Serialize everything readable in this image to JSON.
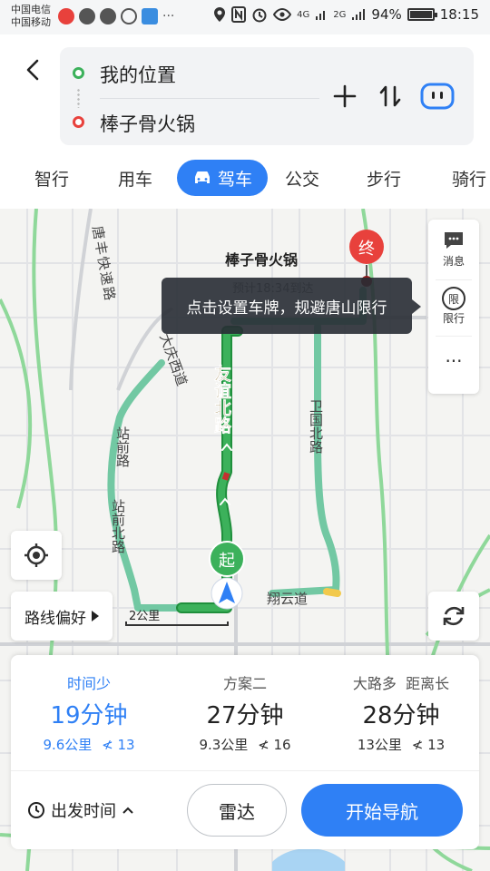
{
  "status_bar": {
    "carrier_1": "中国电信",
    "carrier_2": "中国移动",
    "network_4g": "4G",
    "network_2g": "2G",
    "battery": "94%",
    "battery_level": 0.94,
    "time": "18:15"
  },
  "route": {
    "origin": "我的位置",
    "destination": "棒子骨火锅"
  },
  "modes": [
    "智行",
    "用车",
    "驾车",
    "公交",
    "步行",
    "骑行"
  ],
  "active_mode": "驾车",
  "map": {
    "destination_label": "棒子骨火锅",
    "end_marker": "终",
    "start_marker": "起",
    "tooltip": "点击设置车牌，规避唐山限行",
    "road_labels": [
      "唐丰快速路",
      "友谊北路",
      "卫国北路",
      "站前北路",
      "站前路",
      "翔云道",
      "大庆西道"
    ],
    "eta_strip": "预计18:34到达",
    "scale_label": "2公里"
  },
  "right_panel": {
    "messages": "消息",
    "restriction_icon": "限",
    "restriction": "限行",
    "more": "···"
  },
  "buttons": {
    "route_preference": "路线偏好"
  },
  "plans": [
    {
      "tag": "时间少",
      "duration": "19分钟",
      "distance": "9.6公里",
      "lights": "13"
    },
    {
      "tag": "方案二",
      "duration": "27分钟",
      "distance": "9.3公里",
      "lights": "16"
    },
    {
      "tag": "大路多  距离长",
      "duration": "28分钟",
      "distance": "13公里",
      "lights": "13"
    }
  ],
  "bottom": {
    "depart_time": "出发时间",
    "radar": "雷达",
    "start_nav": "开始导航"
  },
  "colors": {
    "accent": "#2f80f5",
    "route_green": "#3cb15b",
    "route_alt": "#72c8a3",
    "destination_red": "#e8413c",
    "start_green": "#3cb15b"
  }
}
